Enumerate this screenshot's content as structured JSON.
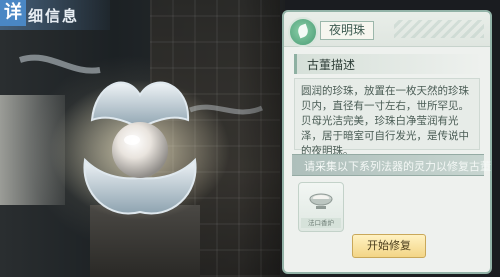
{
  "screen": {
    "title_char": "详",
    "title_text": "细信息"
  },
  "panel": {
    "item_name": "夜明珠",
    "section_title": "古董描述",
    "description": "圆润的珍珠，放置在一枚天然的珍珠贝内，直径有一寸左右，世所罕见。贝母光洁完美，珍珠白净莹润有光泽，居于暗室可自行发光，是传说中的夜明珠。",
    "request_text": "请采集以下系列法器的灵力以修复古董",
    "required_item": {
      "icon": "bowl-icon",
      "label": "法口香炉"
    },
    "repair_button": "开始修复"
  },
  "colors": {
    "title_box": "#4a87c4",
    "panel_bg": "#eef1ee",
    "panel_border": "#93b3a8",
    "button_bg": "#f3d586"
  }
}
